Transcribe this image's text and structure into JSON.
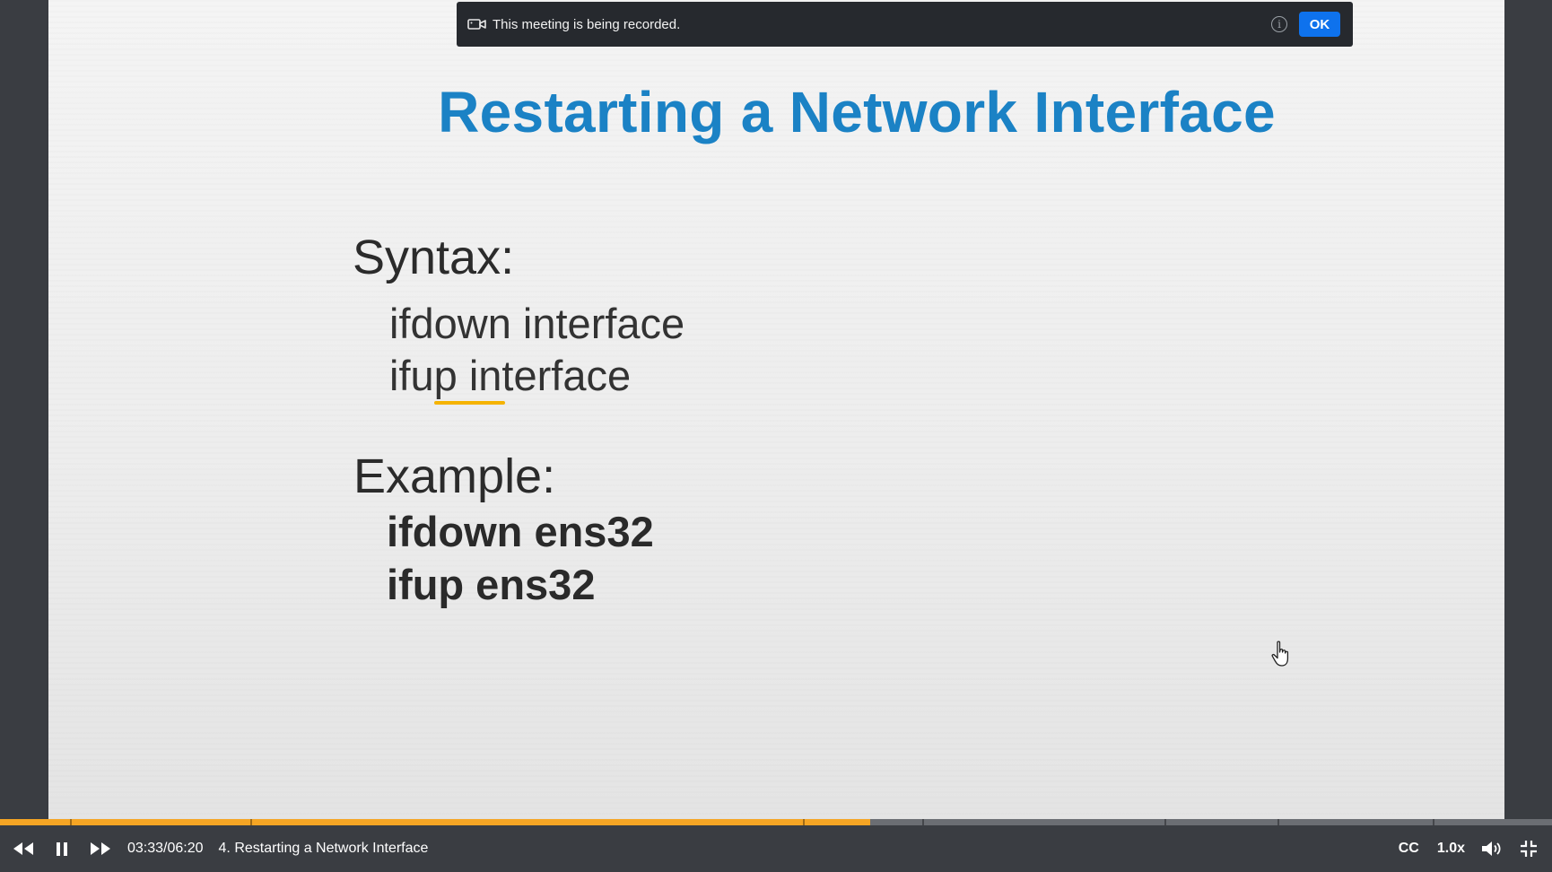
{
  "banner": {
    "message": "This meeting is being recorded.",
    "info_glyph": "i",
    "ok_label": "OK"
  },
  "slide": {
    "title": "Restarting a Network Interface",
    "syntax_heading": "Syntax:",
    "syntax_lines": [
      "ifdown interface",
      "ifup interface"
    ],
    "example_heading": "Example:",
    "example_lines": [
      "ifdown ens32",
      "ifup ens32"
    ]
  },
  "player": {
    "progress": 0.5605,
    "time": "03:33/06:20",
    "chapter_title": "4. Restarting a Network Interface",
    "cc_label": "CC",
    "speed_label": "1.0x",
    "colors": {
      "progress": "#f5a524",
      "accent": "#0e72ed",
      "title": "#1b82c5"
    }
  }
}
